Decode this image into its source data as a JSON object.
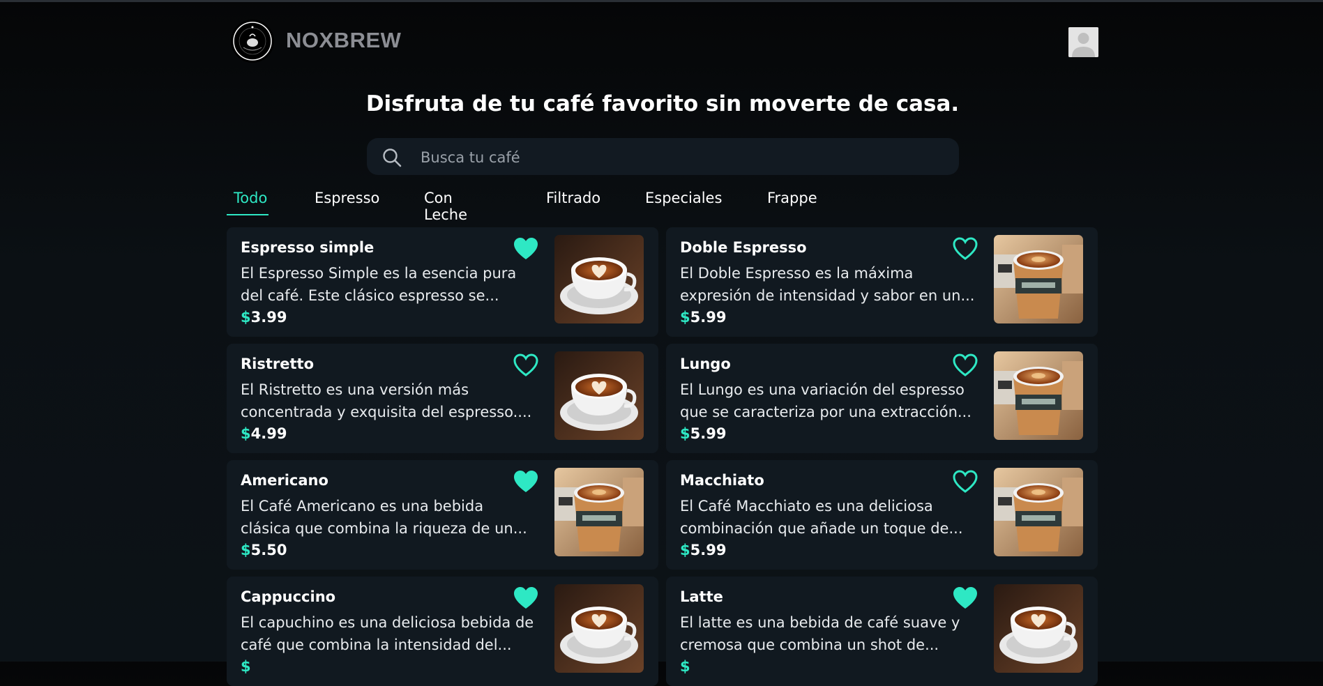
{
  "brand": {
    "name": "NOXBREW"
  },
  "headline": "Disfruta de tu café favorito sin moverte de casa.",
  "search": {
    "placeholder": "Busca tu café"
  },
  "tabs": [
    {
      "label": "Todo",
      "active": true
    },
    {
      "label": "Espresso",
      "active": false
    },
    {
      "label": "Con Leche",
      "active": false
    },
    {
      "label": "Filtrado",
      "active": false
    },
    {
      "label": "Especiales",
      "active": false
    },
    {
      "label": "Frappe",
      "active": false
    }
  ],
  "currency_symbol": "$",
  "products": [
    {
      "name": "Espresso simple",
      "desc1": "El Espresso Simple es la esencia pura",
      "desc2": "del café. Este clásico espresso se...",
      "price": "3.99",
      "favorite": true,
      "image": "latte-art-cup"
    },
    {
      "name": "Doble Espresso",
      "desc1": "El Doble Espresso es la máxima",
      "desc2": "expresión de intensidad y sabor en un...",
      "price": "5.99",
      "favorite": false,
      "image": "takeaway-cup"
    },
    {
      "name": "Ristretto",
      "desc1": "El Ristretto es una versión más",
      "desc2": "concentrada y exquisita del espresso....",
      "price": "4.99",
      "favorite": false,
      "image": "latte-art-cup"
    },
    {
      "name": "Lungo",
      "desc1": "El Lungo es una variación del espresso",
      "desc2": "que se caracteriza por una extracción...",
      "price": "5.99",
      "favorite": false,
      "image": "takeaway-cup"
    },
    {
      "name": "Americano",
      "desc1": "El Café Americano es una bebida",
      "desc2": "clásica que combina la riqueza de un...",
      "price": "5.50",
      "favorite": true,
      "image": "takeaway-cup"
    },
    {
      "name": "Macchiato",
      "desc1": "El Café Macchiato es una deliciosa",
      "desc2": "combinación que añade un toque de...",
      "price": "5.99",
      "favorite": false,
      "image": "takeaway-cup"
    },
    {
      "name": "Cappuccino",
      "desc1": "El capuchino es una deliciosa bebida de",
      "desc2": "café que combina la intensidad del...",
      "price": "",
      "favorite": true,
      "image": "latte-art-cup"
    },
    {
      "name": "Latte",
      "desc1": "El latte es una bebida de café suave y",
      "desc2": "cremosa que combina un shot de...",
      "price": "",
      "favorite": true,
      "image": "latte-art-cup"
    }
  ],
  "colors": {
    "accent": "#2ee8c4",
    "card_bg": "#111920",
    "background": "#0b1014"
  }
}
